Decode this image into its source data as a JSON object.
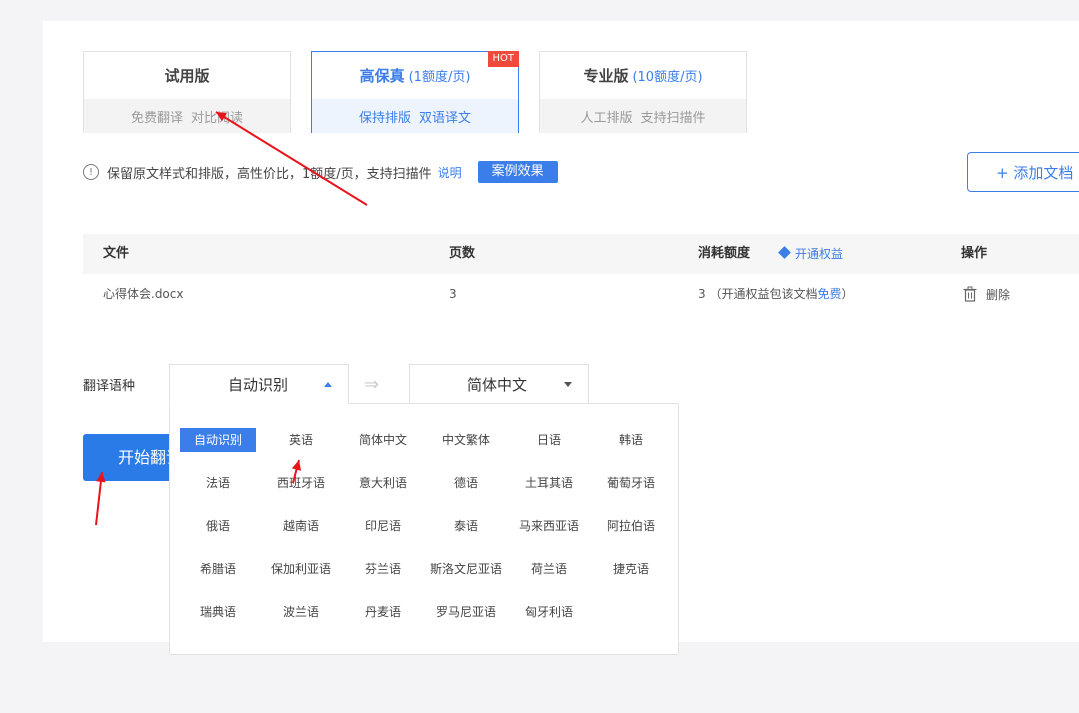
{
  "plans": [
    {
      "name": "试用版",
      "price": "",
      "features": [
        "免费翻译",
        "对比阅读"
      ],
      "badge": ""
    },
    {
      "name": "高保真",
      "price": "(1额度/页)",
      "features": [
        "保持排版",
        "双语译文"
      ],
      "badge": "HOT"
    },
    {
      "name": "专业版",
      "price": "(10额度/页)",
      "features": [
        "人工排版",
        "支持扫描件"
      ],
      "badge": ""
    }
  ],
  "notice": {
    "icon": "!",
    "text": "保留原文样式和排版，高性价比，1额度/页，支持扫描件",
    "explain_link": "说明",
    "case_button": "案例效果"
  },
  "add_doc_button": "+ 添加文档",
  "table": {
    "headers": {
      "file": "文件",
      "pages": "页数",
      "credits": "消耗额度",
      "benefit_link": "开通权益",
      "actions": "操作"
    },
    "rows": [
      {
        "file": "心得体会.docx",
        "pages": "3",
        "credits_prefix": "3 （开通权益包该文档",
        "credits_free": "免费",
        "credits_suffix": "）",
        "delete": "删除"
      }
    ]
  },
  "translate": {
    "label": "翻译语种",
    "source": "自动识别",
    "target": "简体中文",
    "start_button": "开始翻译"
  },
  "languages": [
    "自动识别",
    "英语",
    "简体中文",
    "中文繁体",
    "日语",
    "韩语",
    "法语",
    "西班牙语",
    "意大利语",
    "德语",
    "土耳其语",
    "葡萄牙语",
    "俄语",
    "越南语",
    "印尼语",
    "泰语",
    "马来西亚语",
    "阿拉伯语",
    "希腊语",
    "保加利亚语",
    "芬兰语",
    "斯洛文尼亚语",
    "荷兰语",
    "捷克语",
    "瑞典语",
    "波兰语",
    "丹麦语",
    "罗马尼亚语",
    "匈牙利语"
  ],
  "selected_language_index": 0,
  "colors": {
    "accent": "#3b7de9",
    "hot": "#f04a3c",
    "annotation_arrow": "#e8141c"
  }
}
